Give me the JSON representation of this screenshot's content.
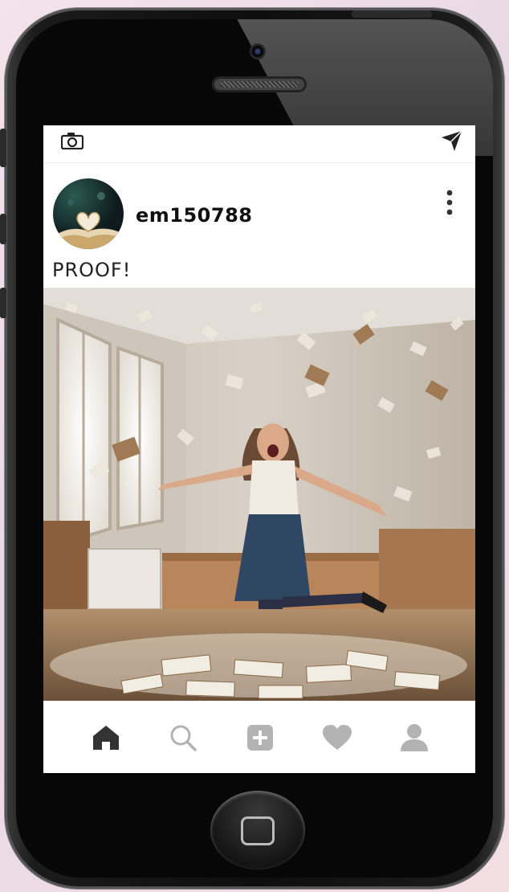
{
  "post": {
    "username": "em150788",
    "caption": "PROOF!"
  },
  "icons": {
    "camera": "camera-icon",
    "direct": "paper-plane-icon",
    "more": "vertical-dots-icon",
    "nav": [
      "home-icon",
      "search-icon",
      "add-post-icon",
      "heart-icon",
      "profile-icon"
    ]
  },
  "colors": {
    "nav_active": "#333333",
    "nav_inactive": "#b3b3b3",
    "screen_bg": "#ffffff"
  }
}
